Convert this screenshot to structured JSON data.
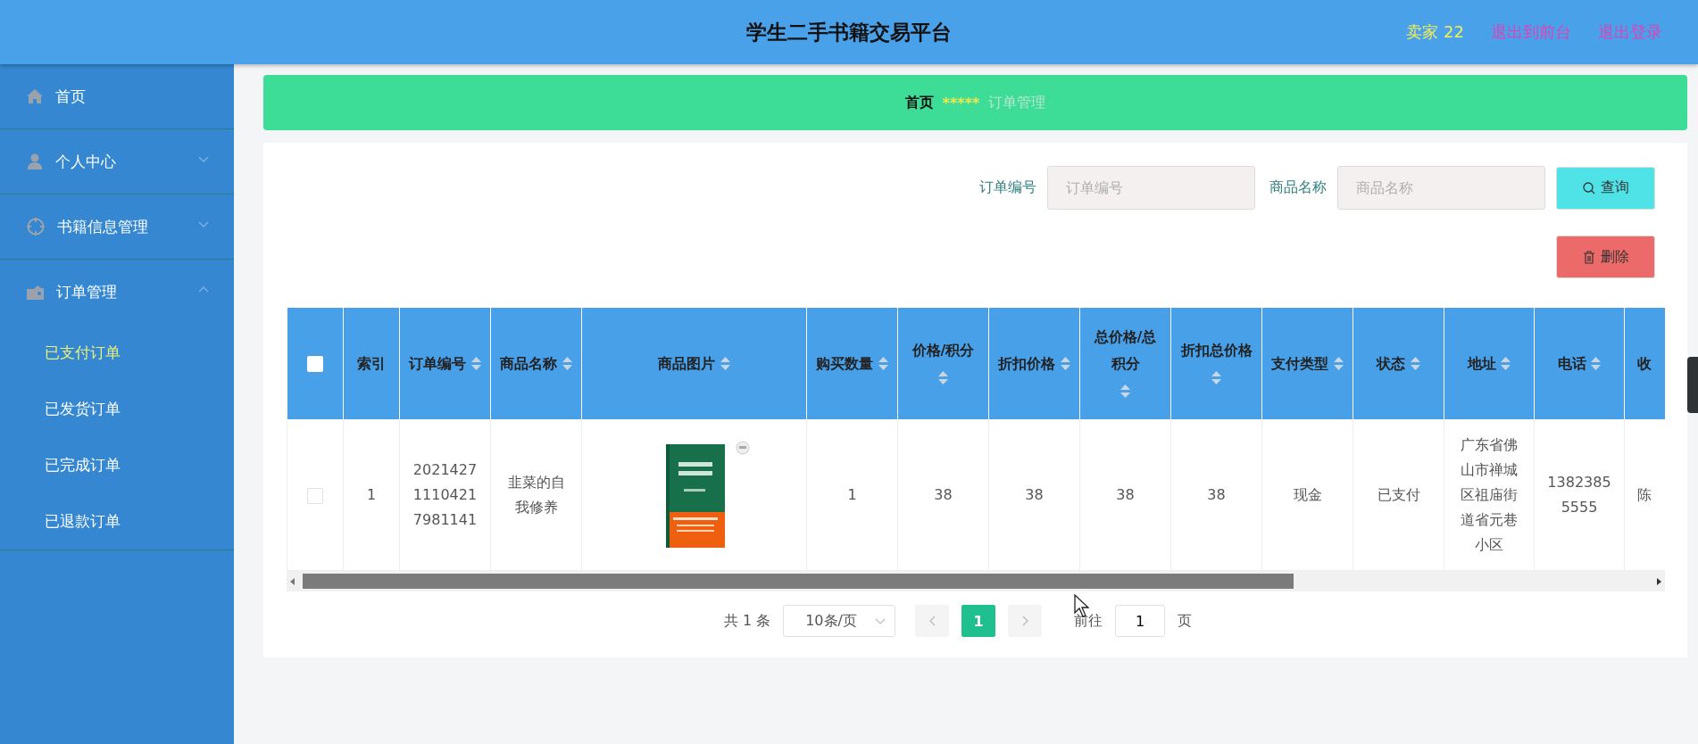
{
  "header": {
    "title": "学生二手书籍交易平台",
    "user_label": "卖家 22",
    "links": [
      "退出到前台",
      "退出登录"
    ]
  },
  "sidebar": {
    "items": [
      {
        "label": "首页"
      },
      {
        "label": "个人中心",
        "expanded": false
      },
      {
        "label": "书籍信息管理",
        "expanded": false
      },
      {
        "label": "订单管理",
        "expanded": true,
        "children": [
          {
            "label": "已支付订单",
            "selected": true
          },
          {
            "label": "已发货订单",
            "selected": false
          },
          {
            "label": "已完成订单",
            "selected": false
          },
          {
            "label": "已退款订单",
            "selected": false
          }
        ]
      }
    ]
  },
  "breadcrumb": {
    "items": [
      "首页",
      "订单管理"
    ],
    "separator": "*****"
  },
  "search": {
    "fields": [
      {
        "label": "订单编号",
        "placeholder": "订单编号"
      },
      {
        "label": "商品名称",
        "placeholder": "商品名称"
      }
    ],
    "query_button": "查询",
    "delete_button": "删除"
  },
  "table": {
    "select_all": {
      "checked": false
    },
    "columns": [
      {
        "label": "索引",
        "sortable": false
      },
      {
        "label": "订单编号",
        "sortable": true
      },
      {
        "label": "商品名称",
        "sortable": true
      },
      {
        "label": "商品图片",
        "sortable": true
      },
      {
        "label": "购买数量",
        "sortable": true
      },
      {
        "label": "价格/积分",
        "sortable": true
      },
      {
        "label": "折扣价格",
        "sortable": true
      },
      {
        "label": "总价格/总积分",
        "sortable": true
      },
      {
        "label": "折扣总价格",
        "sortable": true
      },
      {
        "label": "支付类型",
        "sortable": true
      },
      {
        "label": "状态",
        "sortable": true
      },
      {
        "label": "地址",
        "sortable": true
      },
      {
        "label": "电话",
        "sortable": true
      },
      {
        "label": "收",
        "sortable": false
      }
    ],
    "rows": [
      {
        "checked": false,
        "cells": [
          {
            "kind": "text",
            "text": "1"
          },
          {
            "kind": "text",
            "text": "202142711104217981141"
          },
          {
            "kind": "text",
            "text": "韭菜的自我修养"
          },
          {
            "kind": "picture"
          },
          {
            "kind": "text",
            "text": "1"
          },
          {
            "kind": "text",
            "text": "38"
          },
          {
            "kind": "text",
            "text": "38"
          },
          {
            "kind": "text",
            "text": "38"
          },
          {
            "kind": "text",
            "text": "38"
          },
          {
            "kind": "text",
            "text": "现金"
          },
          {
            "kind": "text",
            "text": "已支付"
          },
          {
            "kind": "text",
            "text": "广东省佛山市禅城区祖庙街道省元巷小区"
          },
          {
            "kind": "text",
            "text": "13823855555"
          },
          {
            "kind": "text",
            "text": "陈"
          }
        ]
      }
    ]
  },
  "pagination": {
    "total": "共 1 条",
    "page_size": "10条/页",
    "pages": [
      {
        "label": "1",
        "selected": true
      }
    ],
    "goto_label": "前往",
    "goto_value": "1",
    "page_suffix": "页"
  }
}
